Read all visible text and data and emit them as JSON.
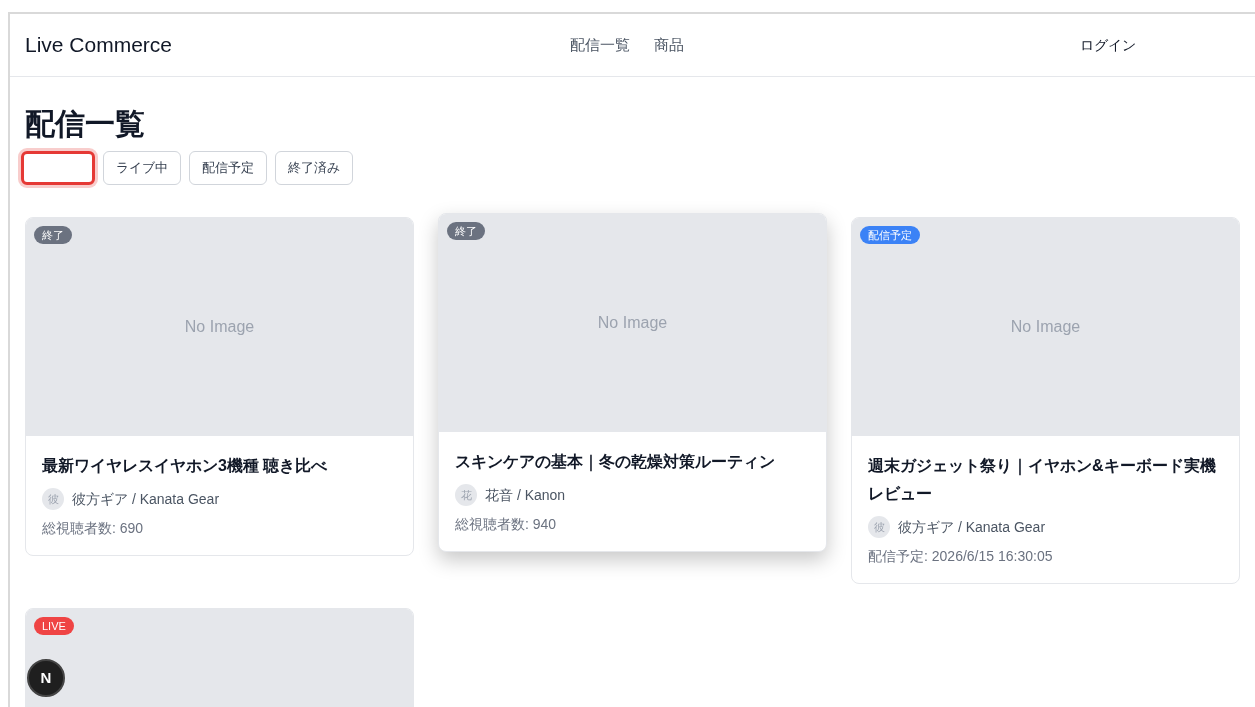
{
  "header": {
    "logo": "Live Commerce",
    "nav": [
      {
        "label": "配信一覧"
      },
      {
        "label": "商品"
      }
    ],
    "login": "ログイン"
  },
  "page_title": "配信一覧",
  "filters": [
    {
      "selected": true
    },
    {
      "label": "ライブ中",
      "selected": false
    },
    {
      "label": "配信予定",
      "selected": false
    },
    {
      "label": "終了済み",
      "selected": false
    }
  ],
  "cards": [
    {
      "status": {
        "kind": "ended",
        "label": "終了"
      },
      "image_text": "No Image",
      "title": "最新ワイヤレスイヤホン3機種 聴き比べ",
      "avatar": "彼",
      "streamer": "彼方ギア / Kanata Gear",
      "meta": "総視聴者数: 690",
      "hovered": false
    },
    {
      "status": {
        "kind": "ended",
        "label": "終了"
      },
      "image_text": "No Image",
      "title": "スキンケアの基本｜冬の乾燥対策ルーティン",
      "avatar": "花",
      "streamer": "花音 / Kanon",
      "meta": "総視聴者数: 940",
      "hovered": true
    },
    {
      "status": {
        "kind": "scheduled",
        "label": "配信予定"
      },
      "image_text": "No Image",
      "title": "週末ガジェット祭り｜イヤホン&キーボード実機レビュー",
      "avatar": "彼",
      "streamer": "彼方ギア / Kanata Gear",
      "meta": "配信予定: 2026/6/15 16:30:05",
      "hovered": false
    },
    {
      "status": {
        "kind": "live",
        "label": "LIVE"
      },
      "hovered": false
    }
  ],
  "dev_badge": "N"
}
